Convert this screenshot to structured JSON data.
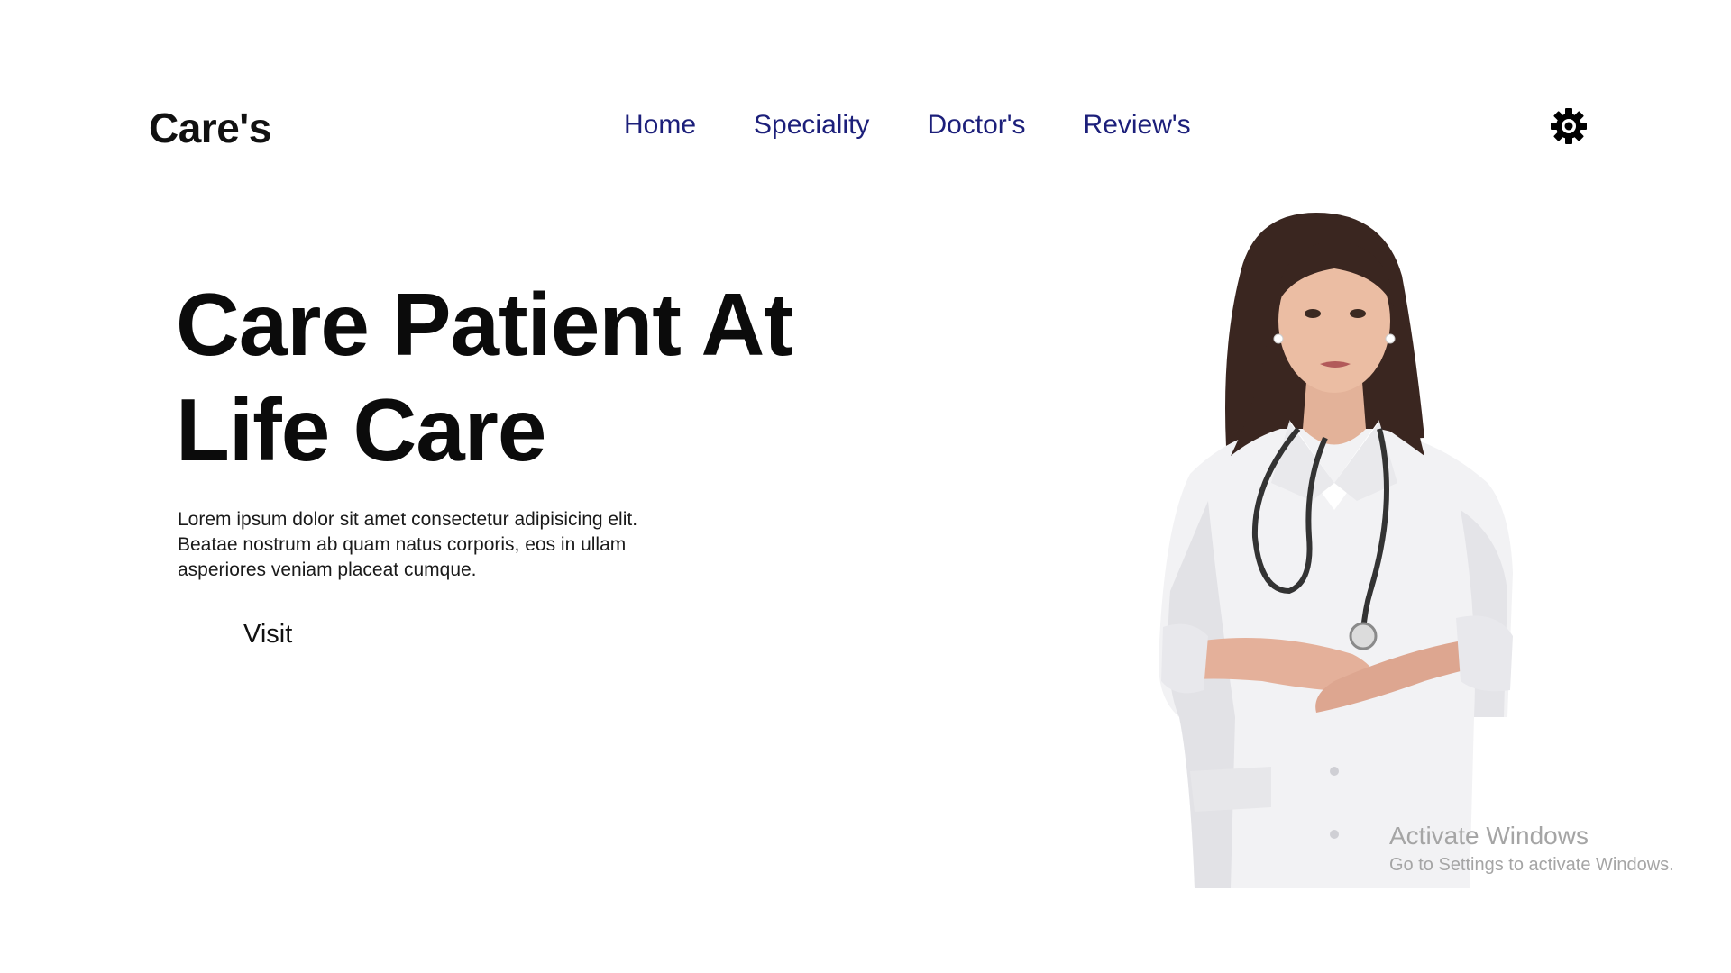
{
  "header": {
    "logo": "Care's",
    "nav": [
      {
        "label": "Home"
      },
      {
        "label": "Speciality"
      },
      {
        "label": "Doctor's"
      },
      {
        "label": "Review's"
      }
    ],
    "theme_toggle_icon": "gear-icon"
  },
  "hero": {
    "title_line_1": "Care Patient At",
    "title_line_2": "Life Care",
    "description": "Lorem ipsum dolor sit amet consectetur adipisicing elit. Beatae nostrum ab quam natus corporis, eos in ullam asperiores veniam placeat cumque.",
    "visit_label": "Visit",
    "image_icon": "doctor-image"
  },
  "watermark": {
    "title": "Activate Windows",
    "subtitle": "Go to Settings to activate Windows."
  },
  "colors": {
    "nav_text": "#1c1f7a",
    "heading": "#0b0b0b",
    "background": "#ffffff",
    "watermark": "#a5a5a5"
  }
}
